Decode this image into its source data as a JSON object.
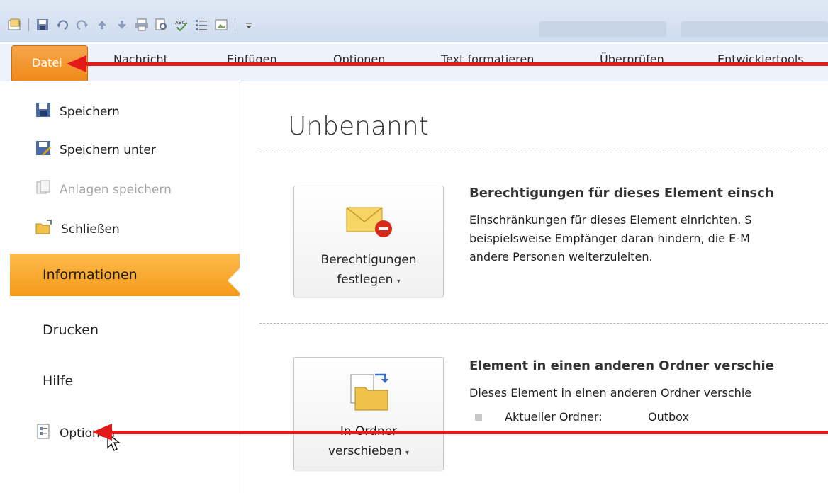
{
  "quick_access": {
    "icons": [
      "app-icon",
      "save-icon",
      "undo-icon",
      "redo-icon",
      "up-arrow-icon",
      "down-arrow-icon",
      "print-icon",
      "preview-icon",
      "spelling-icon",
      "list-icon",
      "image-icon",
      "customize-icon"
    ]
  },
  "ribbon": {
    "tabs": [
      "Datei",
      "Nachricht",
      "Einfügen",
      "Optionen",
      "Text formatieren",
      "Überprüfen",
      "Entwicklertools"
    ]
  },
  "backstage_menu": {
    "small_items": [
      {
        "label": "Speichern",
        "icon": "save-icon",
        "enabled": true
      },
      {
        "label": "Speichern unter",
        "icon": "save-as-icon",
        "enabled": true
      },
      {
        "label": "Anlagen speichern",
        "icon": "attachments-icon",
        "enabled": false
      },
      {
        "label": "Schließen",
        "icon": "folder-close-icon",
        "enabled": true
      }
    ],
    "nav": [
      "Informationen",
      "Drucken",
      "Hilfe"
    ],
    "selected": "Informationen",
    "options_label": "Optionen"
  },
  "content": {
    "title": "Unbenannt",
    "permissions": {
      "button_line1": "Berechtigungen",
      "button_line2": "festlegen",
      "heading": "Berechtigungen für dieses Element einsch",
      "desc1": "Einschränkungen für dieses Element einrichten. S",
      "desc2": "beispielsweise Empfänger daran hindern, die E-M",
      "desc3": "andere Personen weiterzuleiten."
    },
    "move": {
      "button_line1": "In Ordner",
      "button_line2": "verschieben",
      "heading": "Element in einen anderen Ordner verschie",
      "desc1": "Dieses Element in einen anderen Ordner verschie",
      "folder_label": "Aktueller Ordner:",
      "folder_value": "Outbox"
    }
  },
  "colors": {
    "accent_orange": "#f59a1a",
    "annotation_red": "#e41a1a"
  }
}
